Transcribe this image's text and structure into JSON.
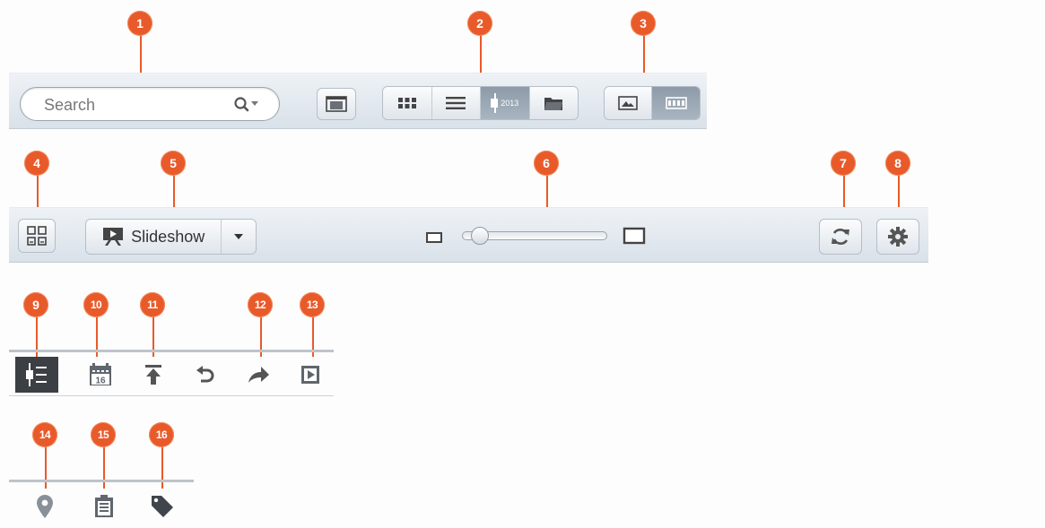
{
  "toolbar_top": {
    "search": {
      "placeholder": "Search",
      "value": ""
    },
    "view_modes": [
      "thumbnail-grid",
      "list",
      "timeline-2013",
      "folder"
    ],
    "timeline_label": "2013",
    "display_modes": [
      "photo",
      "filmstrip"
    ]
  },
  "toolbar_middle": {
    "slideshow_label": "Slideshow"
  },
  "callouts": [
    "1",
    "2",
    "3",
    "4",
    "5",
    "6",
    "7",
    "8",
    "9",
    "10",
    "11",
    "12",
    "13",
    "14",
    "15",
    "16"
  ],
  "calendar_day": "16",
  "colors": {
    "badge": "#e85a2a",
    "active_tab": "#3c3f43",
    "icon_gray": "#666d75"
  }
}
